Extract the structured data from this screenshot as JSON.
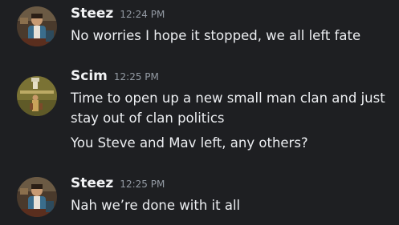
{
  "messages": [
    {
      "author": "Steez",
      "time": "12:24 PM",
      "avatar_icon": "person-photo-avatar",
      "lines": [
        "No worries I hope it stopped, we all left fate"
      ]
    },
    {
      "author": "Scim",
      "time": "12:25 PM",
      "avatar_icon": "game-character-avatar",
      "lines": [
        "Time to open up a new small man clan and just",
        "stay out of clan politics",
        "You Steve and Mav left, any others?"
      ]
    },
    {
      "author": "Steez",
      "time": "12:25 PM",
      "avatar_icon": "person-photo-avatar",
      "lines": [
        "Nah we’re done with it all"
      ]
    }
  ]
}
